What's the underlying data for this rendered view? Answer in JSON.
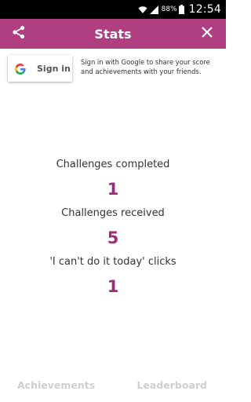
{
  "status_bar": {
    "battery_percent": "88%",
    "time": "12:54"
  },
  "app_bar": {
    "title": "Stats",
    "accent_color": "#b03f82"
  },
  "sign_in": {
    "button_label": "Sign in",
    "description": "Sign in with Google to share your score and achievements with your friends."
  },
  "stats": [
    {
      "label": "Challenges completed",
      "value": "1"
    },
    {
      "label": "Challenges received",
      "value": "5"
    },
    {
      "label": "'I can't do it today' clicks",
      "value": "1"
    }
  ],
  "bottom_nav": {
    "achievements_label": "Achievements",
    "leaderboard_label": "Leaderboard"
  },
  "colors": {
    "value_color": "#9e2c7c",
    "disabled_tab_color": "#cfcfcf"
  }
}
